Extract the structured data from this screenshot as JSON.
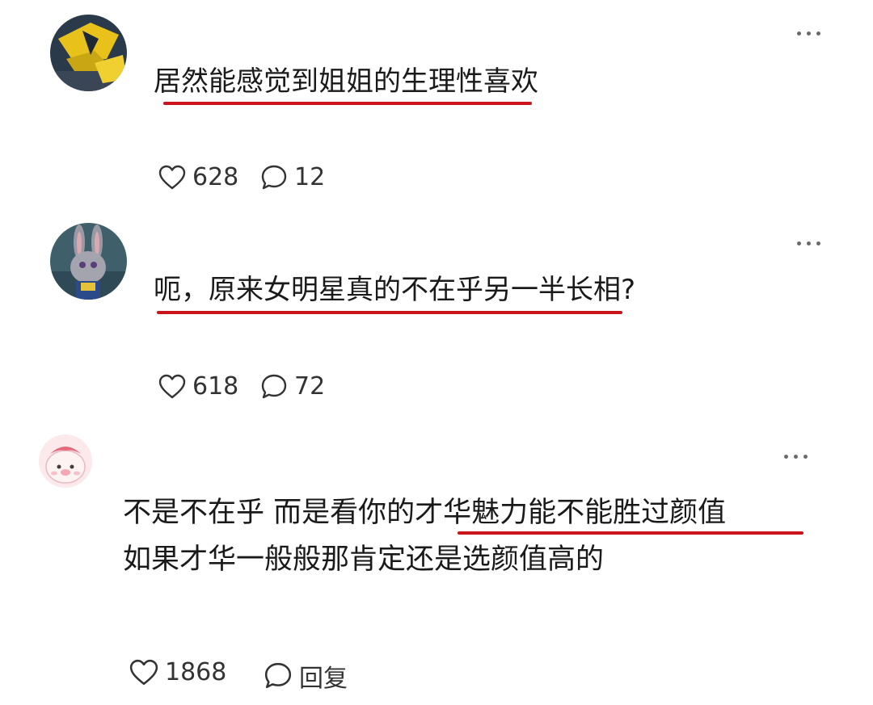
{
  "comments": [
    {
      "text": "居然能感觉到姐姐的生理性喜欢",
      "likes": "628",
      "replies": "12"
    },
    {
      "text": "呃，原来女明星真的不在乎另一半长相?",
      "likes": "618",
      "replies": "72"
    },
    {
      "line1": "不是不在乎 而是看你的才华魅力能不能胜过颜值",
      "line2": "如果才华一般般那肯定还是选颜值高的",
      "likes": "1868",
      "reply_label": "回复"
    }
  ],
  "icons": {
    "like": "heart-outline-icon",
    "comment": "speech-bubble-icon",
    "more": "ellipsis-icon"
  },
  "colors": {
    "underline": "#c9141c",
    "text": "#1a1a1a",
    "icon": "#333333"
  }
}
